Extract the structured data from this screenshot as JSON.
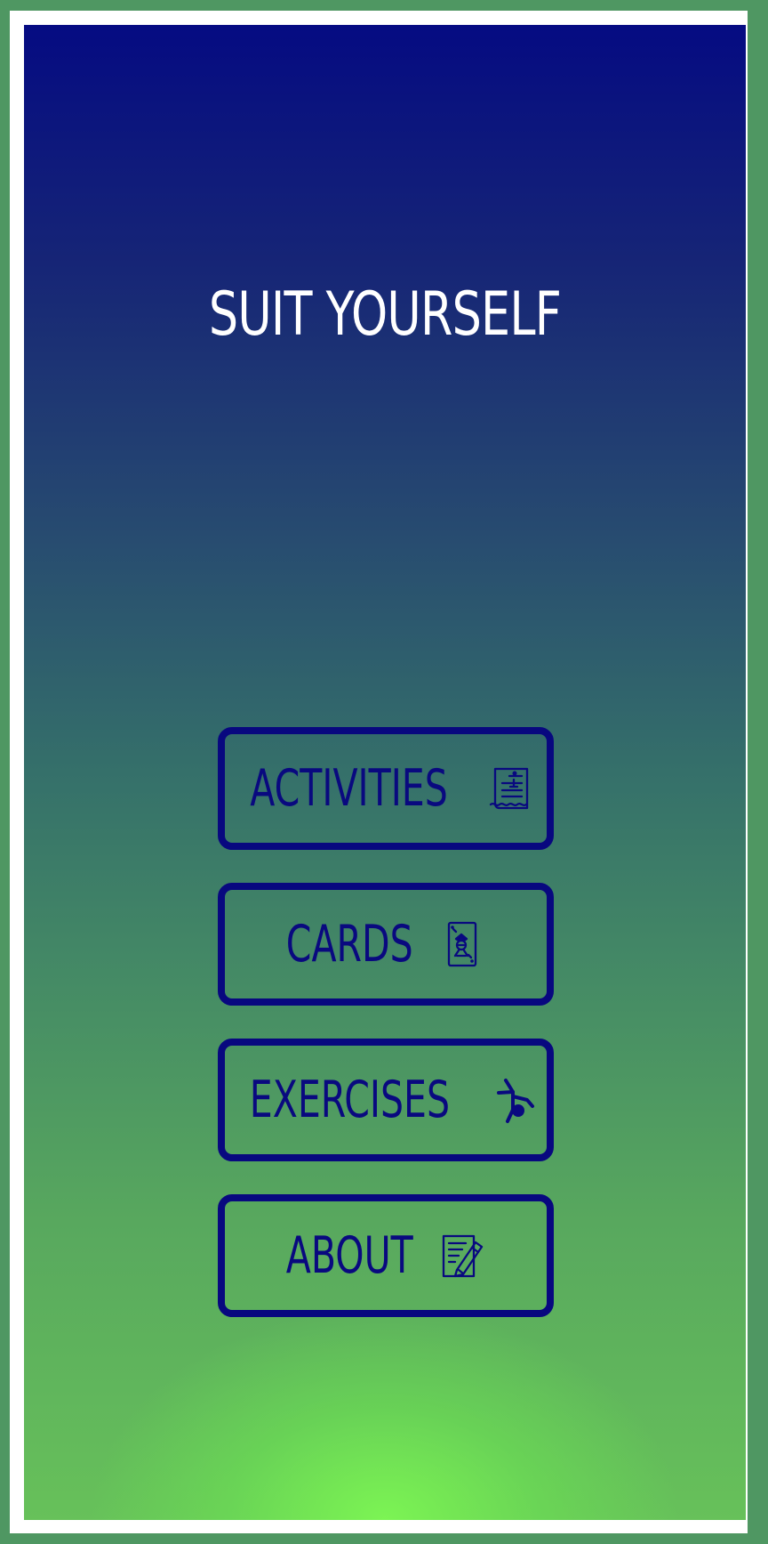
{
  "app": {
    "title": "SUIT YOURSELF"
  },
  "menu": {
    "items": [
      {
        "label": "ACTIVITIES",
        "icon": "receipt-icon"
      },
      {
        "label": "CARDS",
        "icon": "joker-card-icon"
      },
      {
        "label": "EXERCISES",
        "icon": "cartwheel-icon"
      },
      {
        "label": "ABOUT",
        "icon": "notepad-pencil-icon"
      }
    ]
  },
  "colors": {
    "background_frame": "#4f9762",
    "border_white": "#ffffff",
    "gradient_top": "#050b82",
    "gradient_middle": "#35706a",
    "gradient_bottom": "#7df753",
    "button_blue": "#08087f",
    "title_text": "#ffffff"
  }
}
